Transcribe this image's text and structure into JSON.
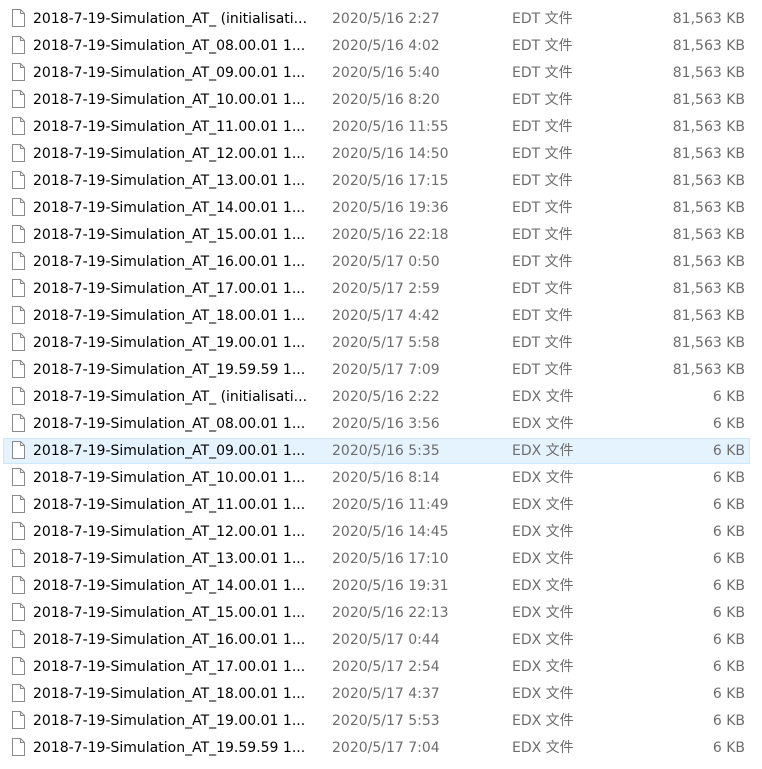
{
  "files": [
    {
      "name": "2018-7-19-Simulation_AT_ (initialisati...",
      "date": "2020/5/16 2:27",
      "type": "EDT 文件",
      "size": "81,563 KB",
      "icon": "generic-file-icon",
      "selected": false
    },
    {
      "name": "2018-7-19-Simulation_AT_08.00.01 1...",
      "date": "2020/5/16 4:02",
      "type": "EDT 文件",
      "size": "81,563 KB",
      "icon": "generic-file-icon",
      "selected": false
    },
    {
      "name": "2018-7-19-Simulation_AT_09.00.01 1...",
      "date": "2020/5/16 5:40",
      "type": "EDT 文件",
      "size": "81,563 KB",
      "icon": "generic-file-icon",
      "selected": false
    },
    {
      "name": "2018-7-19-Simulation_AT_10.00.01 1...",
      "date": "2020/5/16 8:20",
      "type": "EDT 文件",
      "size": "81,563 KB",
      "icon": "generic-file-icon",
      "selected": false
    },
    {
      "name": "2018-7-19-Simulation_AT_11.00.01 1...",
      "date": "2020/5/16 11:55",
      "type": "EDT 文件",
      "size": "81,563 KB",
      "icon": "generic-file-icon",
      "selected": false
    },
    {
      "name": "2018-7-19-Simulation_AT_12.00.01 1...",
      "date": "2020/5/16 14:50",
      "type": "EDT 文件",
      "size": "81,563 KB",
      "icon": "generic-file-icon",
      "selected": false
    },
    {
      "name": "2018-7-19-Simulation_AT_13.00.01 1...",
      "date": "2020/5/16 17:15",
      "type": "EDT 文件",
      "size": "81,563 KB",
      "icon": "generic-file-icon",
      "selected": false
    },
    {
      "name": "2018-7-19-Simulation_AT_14.00.01 1...",
      "date": "2020/5/16 19:36",
      "type": "EDT 文件",
      "size": "81,563 KB",
      "icon": "generic-file-icon",
      "selected": false
    },
    {
      "name": "2018-7-19-Simulation_AT_15.00.01 1...",
      "date": "2020/5/16 22:18",
      "type": "EDT 文件",
      "size": "81,563 KB",
      "icon": "generic-file-icon",
      "selected": false
    },
    {
      "name": "2018-7-19-Simulation_AT_16.00.01 1...",
      "date": "2020/5/17 0:50",
      "type": "EDT 文件",
      "size": "81,563 KB",
      "icon": "generic-file-icon",
      "selected": false
    },
    {
      "name": "2018-7-19-Simulation_AT_17.00.01 1...",
      "date": "2020/5/17 2:59",
      "type": "EDT 文件",
      "size": "81,563 KB",
      "icon": "generic-file-icon",
      "selected": false
    },
    {
      "name": "2018-7-19-Simulation_AT_18.00.01 1...",
      "date": "2020/5/17 4:42",
      "type": "EDT 文件",
      "size": "81,563 KB",
      "icon": "generic-file-icon",
      "selected": false
    },
    {
      "name": "2018-7-19-Simulation_AT_19.00.01 1...",
      "date": "2020/5/17 5:58",
      "type": "EDT 文件",
      "size": "81,563 KB",
      "icon": "generic-file-icon",
      "selected": false
    },
    {
      "name": "2018-7-19-Simulation_AT_19.59.59 1...",
      "date": "2020/5/17 7:09",
      "type": "EDT 文件",
      "size": "81,563 KB",
      "icon": "generic-file-icon",
      "selected": false
    },
    {
      "name": "2018-7-19-Simulation_AT_ (initialisati...",
      "date": "2020/5/16 2:22",
      "type": "EDX 文件",
      "size": "6 KB",
      "icon": "generic-file-icon",
      "selected": false
    },
    {
      "name": "2018-7-19-Simulation_AT_08.00.01 1...",
      "date": "2020/5/16 3:56",
      "type": "EDX 文件",
      "size": "6 KB",
      "icon": "generic-file-icon",
      "selected": false
    },
    {
      "name": "2018-7-19-Simulation_AT_09.00.01 1...",
      "date": "2020/5/16 5:35",
      "type": "EDX 文件",
      "size": "6 KB",
      "icon": "generic-file-icon",
      "selected": true
    },
    {
      "name": "2018-7-19-Simulation_AT_10.00.01 1...",
      "date": "2020/5/16 8:14",
      "type": "EDX 文件",
      "size": "6 KB",
      "icon": "generic-file-icon",
      "selected": false
    },
    {
      "name": "2018-7-19-Simulation_AT_11.00.01 1...",
      "date": "2020/5/16 11:49",
      "type": "EDX 文件",
      "size": "6 KB",
      "icon": "generic-file-icon",
      "selected": false
    },
    {
      "name": "2018-7-19-Simulation_AT_12.00.01 1...",
      "date": "2020/5/16 14:45",
      "type": "EDX 文件",
      "size": "6 KB",
      "icon": "generic-file-icon",
      "selected": false
    },
    {
      "name": "2018-7-19-Simulation_AT_13.00.01 1...",
      "date": "2020/5/16 17:10",
      "type": "EDX 文件",
      "size": "6 KB",
      "icon": "generic-file-icon",
      "selected": false
    },
    {
      "name": "2018-7-19-Simulation_AT_14.00.01 1...",
      "date": "2020/5/16 19:31",
      "type": "EDX 文件",
      "size": "6 KB",
      "icon": "generic-file-icon",
      "selected": false
    },
    {
      "name": "2018-7-19-Simulation_AT_15.00.01 1...",
      "date": "2020/5/16 22:13",
      "type": "EDX 文件",
      "size": "6 KB",
      "icon": "generic-file-icon",
      "selected": false
    },
    {
      "name": "2018-7-19-Simulation_AT_16.00.01 1...",
      "date": "2020/5/17 0:44",
      "type": "EDX 文件",
      "size": "6 KB",
      "icon": "generic-file-icon",
      "selected": false
    },
    {
      "name": "2018-7-19-Simulation_AT_17.00.01 1...",
      "date": "2020/5/17 2:54",
      "type": "EDX 文件",
      "size": "6 KB",
      "icon": "generic-file-icon",
      "selected": false
    },
    {
      "name": "2018-7-19-Simulation_AT_18.00.01 1...",
      "date": "2020/5/17 4:37",
      "type": "EDX 文件",
      "size": "6 KB",
      "icon": "generic-file-icon",
      "selected": false
    },
    {
      "name": "2018-7-19-Simulation_AT_19.00.01 1...",
      "date": "2020/5/17 5:53",
      "type": "EDX 文件",
      "size": "6 KB",
      "icon": "generic-file-icon",
      "selected": false
    },
    {
      "name": "2018-7-19-Simulation_AT_19.59.59 1...",
      "date": "2020/5/17 7:04",
      "type": "EDX 文件",
      "size": "6 KB",
      "icon": "generic-file-icon",
      "selected": false
    }
  ],
  "colors": {
    "selection_fill": "#e5f3ff",
    "selection_border": "#cce8ff",
    "name_text": "#000000",
    "detail_text": "#6d6d6d"
  }
}
